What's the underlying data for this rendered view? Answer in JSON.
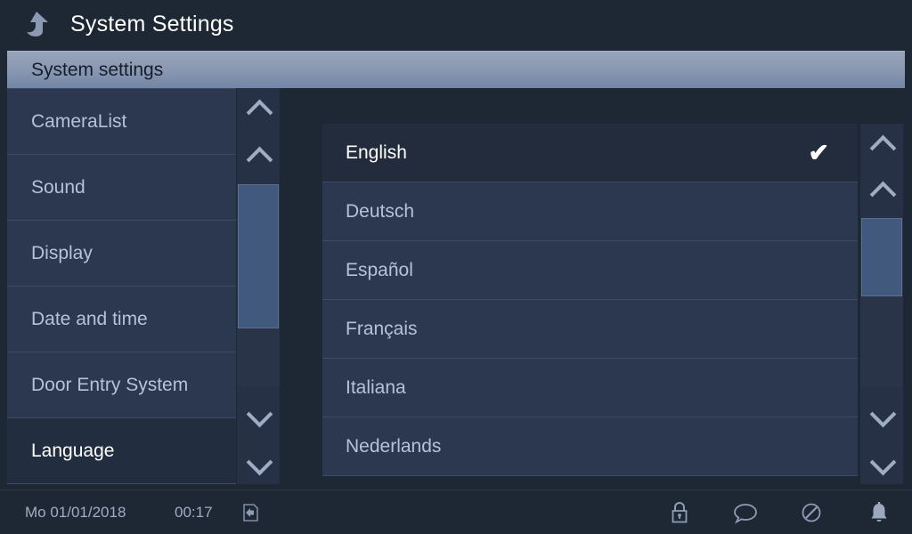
{
  "header": {
    "title": "System Settings",
    "back_icon": "back-arrow-icon"
  },
  "breadcrumb": {
    "label": "System settings"
  },
  "sidebar": {
    "items": [
      {
        "label": "CameraList",
        "selected": false
      },
      {
        "label": "Sound",
        "selected": false
      },
      {
        "label": "Display",
        "selected": false
      },
      {
        "label": "Date and time",
        "selected": false
      },
      {
        "label": "Door Entry System",
        "selected": false
      },
      {
        "label": "Language",
        "selected": true
      }
    ],
    "scrollbar": {
      "up_icon": "chevron-up-icon",
      "down_icon": "chevron-down-icon"
    }
  },
  "language_list": {
    "items": [
      {
        "label": "English",
        "selected": true,
        "check": "✔"
      },
      {
        "label": "Deutsch",
        "selected": false,
        "check": ""
      },
      {
        "label": "Español",
        "selected": false,
        "check": ""
      },
      {
        "label": "Français",
        "selected": false,
        "check": ""
      },
      {
        "label": "Italiana",
        "selected": false,
        "check": ""
      },
      {
        "label": "Nederlands",
        "selected": false,
        "check": ""
      }
    ],
    "scrollbar": {
      "up_icon": "chevron-up-icon",
      "down_icon": "chevron-down-icon"
    }
  },
  "statusbar": {
    "date": "Mo 01/01/2018",
    "time": "00:17",
    "icons": [
      "sd-card-icon",
      "lock-icon",
      "chat-bubble-icon",
      "mute-icon",
      "bell-icon"
    ]
  },
  "colors": {
    "window_background": "#1e2834",
    "panel_background": "#2b3850",
    "selected_background": "#232c3d",
    "breadcrumb_background": "#8c99b2",
    "text_primary": "#ffffff",
    "text_secondary": "#b6c2d6",
    "scrollbar_thumb": "#41597d"
  }
}
